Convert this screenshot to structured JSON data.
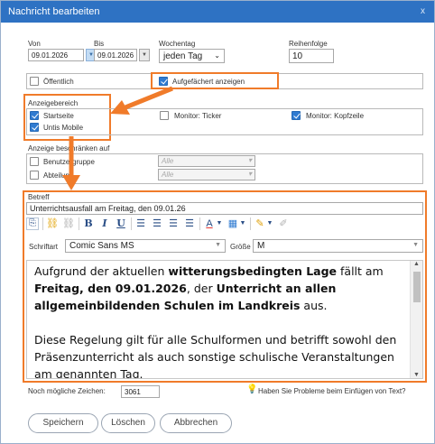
{
  "window": {
    "title": "Nachricht bearbeiten",
    "close_glyph": "x"
  },
  "dates": {
    "von_label": "Von",
    "von_value": "09.01.2026",
    "bis_label": "Bis",
    "bis_value": "09.01.2026",
    "wochentag_label": "Wochentag",
    "wochentag_value": "jeden Tag",
    "reihenfolge_label": "Reihenfolge",
    "reihenfolge_value": "10"
  },
  "options": {
    "oeffentlich_label": "Öffentlich",
    "oeffentlich_checked": false,
    "aufgefaechert_label": "Aufgefächert anzeigen",
    "aufgefaechert_checked": true
  },
  "anzeigebereich": {
    "label": "Anzeigebereich",
    "items": [
      {
        "label": "Startseite",
        "checked": true
      },
      {
        "label": "Untis Mobile",
        "checked": true
      },
      {
        "label": "Monitor: Ticker",
        "checked": false
      },
      {
        "label": "Monitor: Kopfzeile",
        "checked": true
      }
    ]
  },
  "restrict": {
    "label": "Anzeige beschränken auf",
    "items": [
      {
        "label": "Benutzergruppe",
        "value": "Alle"
      },
      {
        "label": "Abteilung",
        "value": "Alle"
      }
    ]
  },
  "betreff": {
    "label": "Betreff",
    "value": "Unterrichtsausfall am Freitag, den 09.01.26"
  },
  "toolbar": {
    "bold": "B",
    "italic": "I",
    "underline": "U",
    "font_label": "Schriftart",
    "font_value": "Comic Sans MS",
    "size_label": "Größe",
    "size_value": "M"
  },
  "body": {
    "p1_a": "Aufgrund der aktuellen ",
    "p1_b": "witterungsbedingten Lage",
    "p1_c": " fällt am ",
    "p1_d": "Freitag, den 09.01.2026",
    "p1_e": ", der ",
    "p1_f": "Unterricht an allen allgemeinbildenden Schulen im Landkreis",
    "p1_g": " aus.",
    "p2": "Diese Regelung gilt für alle Schulformen und betrifft sowohl den Präsenzunterricht als auch sonstige schulische Veranstaltungen am genannten Tag."
  },
  "footer": {
    "chars_label": "Noch mögliche Zeichen:",
    "chars_value": "3061",
    "help_text": "Haben Sie Probleme beim Einfügen von Text?"
  },
  "buttons": {
    "save": "Speichern",
    "delete": "Löschen",
    "cancel": "Abbrechen"
  },
  "colors": {
    "title_bar": "#2e72c3",
    "highlight": "#f07b2a",
    "checkbox": "#2f7bd1"
  }
}
